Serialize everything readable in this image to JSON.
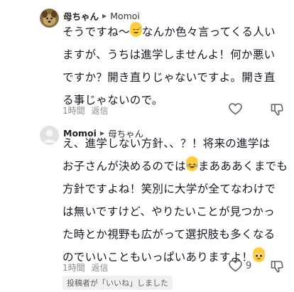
{
  "comment1": {
    "author": "母ちゃん",
    "reply_to": "Momoi",
    "text_lines": [
      "そうですね〜",
      "なんか色々言ってくる人い",
      "ますが、うちは進学しませんよ！何か悪い",
      "ですか？開き直りじゃないですよ。開き直",
      "る事じゃないので。"
    ],
    "time": "1時間",
    "reply_label": "返信",
    "like_count": ""
  },
  "comment2": {
    "author": "Momoi",
    "reply_to": "母ちゃん",
    "text_lines": [
      "え、進学しない方針、、？！将来の進学は",
      "お子さんが決めるのでは",
      "まあああくまでも",
      "方針ですよね！笑別に大学が全てなわけで",
      "は無いですけど、やりたいことが見つかっ",
      "た時とか視野も広がって選択肢も多くなる",
      "のでいいこともいっぱいありますよ！"
    ],
    "time": "1時間",
    "reply_label": "返信",
    "like_count": "9",
    "liked_badge": "投稿者が「いいね」しました"
  },
  "icons": [
    "avatar-dog",
    "avatar-default",
    "sweat-smile-emoji",
    "laughing-emoji",
    "pleading-emoji",
    "heart-icon",
    "dislike-icon"
  ]
}
